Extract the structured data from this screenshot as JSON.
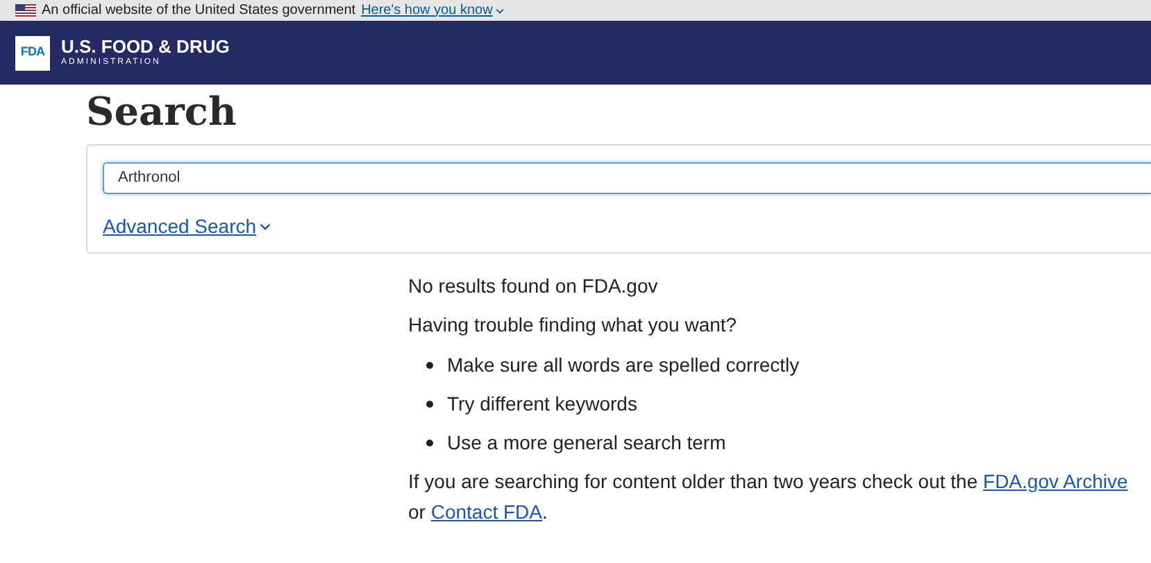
{
  "gov_banner": {
    "text": "An official website of the United States government",
    "link": "Here's how you know"
  },
  "header": {
    "logo": "FDA",
    "title": "U.S. FOOD & DRUG",
    "subtitle": "ADMINISTRATION"
  },
  "page_title": "Search",
  "search": {
    "value": "Arthronol",
    "advanced_link": "Advanced Search"
  },
  "results": {
    "message": "No results found on FDA.gov",
    "help_heading": "Having trouble finding what you want?",
    "tips": [
      "Make sure all words are spelled correctly",
      "Try different keywords",
      "Use a more general search term"
    ],
    "older": {
      "before": "If you are searching for content older than two years check out the",
      "archive_link": "FDA.gov Archive",
      "middle": "or",
      "contact_link": "Contact FDA",
      "after": "."
    }
  }
}
